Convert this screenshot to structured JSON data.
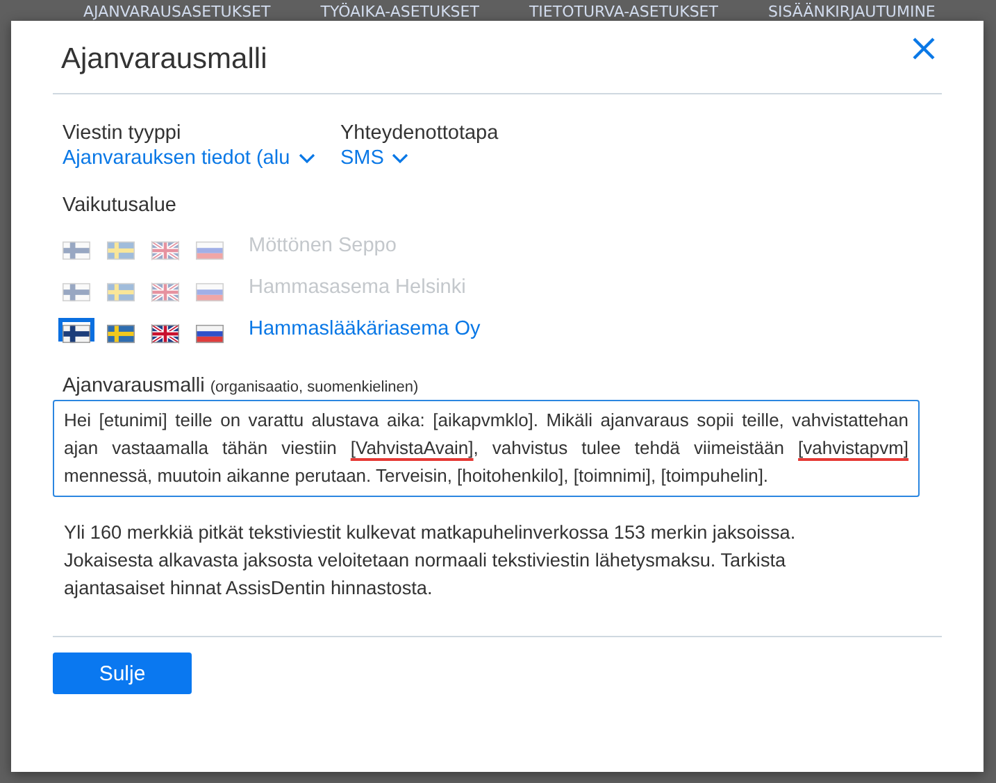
{
  "background": {
    "tabs": [
      "AJANVARAUSASETUKSET",
      "TYÖAIKA-ASETUKSET",
      "TIETOTURVA-ASETUKSET",
      "SISÄÄNKIRJAUTUMINE"
    ]
  },
  "dialog": {
    "title": "Ajanvarausmalli",
    "selectors": [
      {
        "label": "Viestin tyyppi",
        "value": "Ajanvarauksen tiedot (alu"
      },
      {
        "label": "Yhteydenottotapa",
        "value": "SMS"
      }
    ],
    "scope_label": "Vaikutusalue",
    "scopes": [
      {
        "name": "Möttönen Seppo",
        "enabled": false,
        "flags": [
          {
            "kind": "fi",
            "selected": false
          },
          {
            "kind": "se",
            "selected": false
          },
          {
            "kind": "gb",
            "selected": false
          },
          {
            "kind": "ru",
            "selected": false
          }
        ]
      },
      {
        "name": "Hammasasema Helsinki",
        "enabled": false,
        "flags": [
          {
            "kind": "fi",
            "selected": false
          },
          {
            "kind": "se",
            "selected": false
          },
          {
            "kind": "gb",
            "selected": false
          },
          {
            "kind": "ru",
            "selected": false
          }
        ]
      },
      {
        "name": "Hammaslääkäriasema Oy",
        "enabled": true,
        "flags": [
          {
            "kind": "fi",
            "selected": true
          },
          {
            "kind": "se",
            "selected": false
          },
          {
            "kind": "gb",
            "selected": false
          },
          {
            "kind": "ru",
            "selected": false
          }
        ]
      }
    ],
    "template": {
      "label": "Ajanvarausmalli",
      "note": "(organisaatio, suomenkielinen)",
      "segments": [
        {
          "text": "Hei [etunimi] teille on varattu alustava aika: [aikapvmklo]. Mikäli ajanvaraus sopii teille, vahvistattehan ajan vastaamalla tähän viestiin ",
          "flagged": false
        },
        {
          "text": "[VahvistaAvain]",
          "flagged": true
        },
        {
          "text": ", vahvistus tulee tehdä viimeistään ",
          "flagged": false
        },
        {
          "text": "[vahvistapvm]",
          "flagged": true
        },
        {
          "text": " mennessä, muutoin aikanne perutaan. Terveisin, [hoitohenkilo], [toimnimi], [toimpuhelin].",
          "flagged": false
        }
      ]
    },
    "info": "Yli 160 merkkiä pitkät tekstiviestit kulkevat matkapuhelinverkossa 153 merkin jaksoissa. Jokaisesta alkavasta jaksosta veloitetaan normaali tekstiviestin lähetysmaksu. Tarkista ajantasaiset hinnat AssisDentin hinnastosta.",
    "button": "Sulje"
  }
}
